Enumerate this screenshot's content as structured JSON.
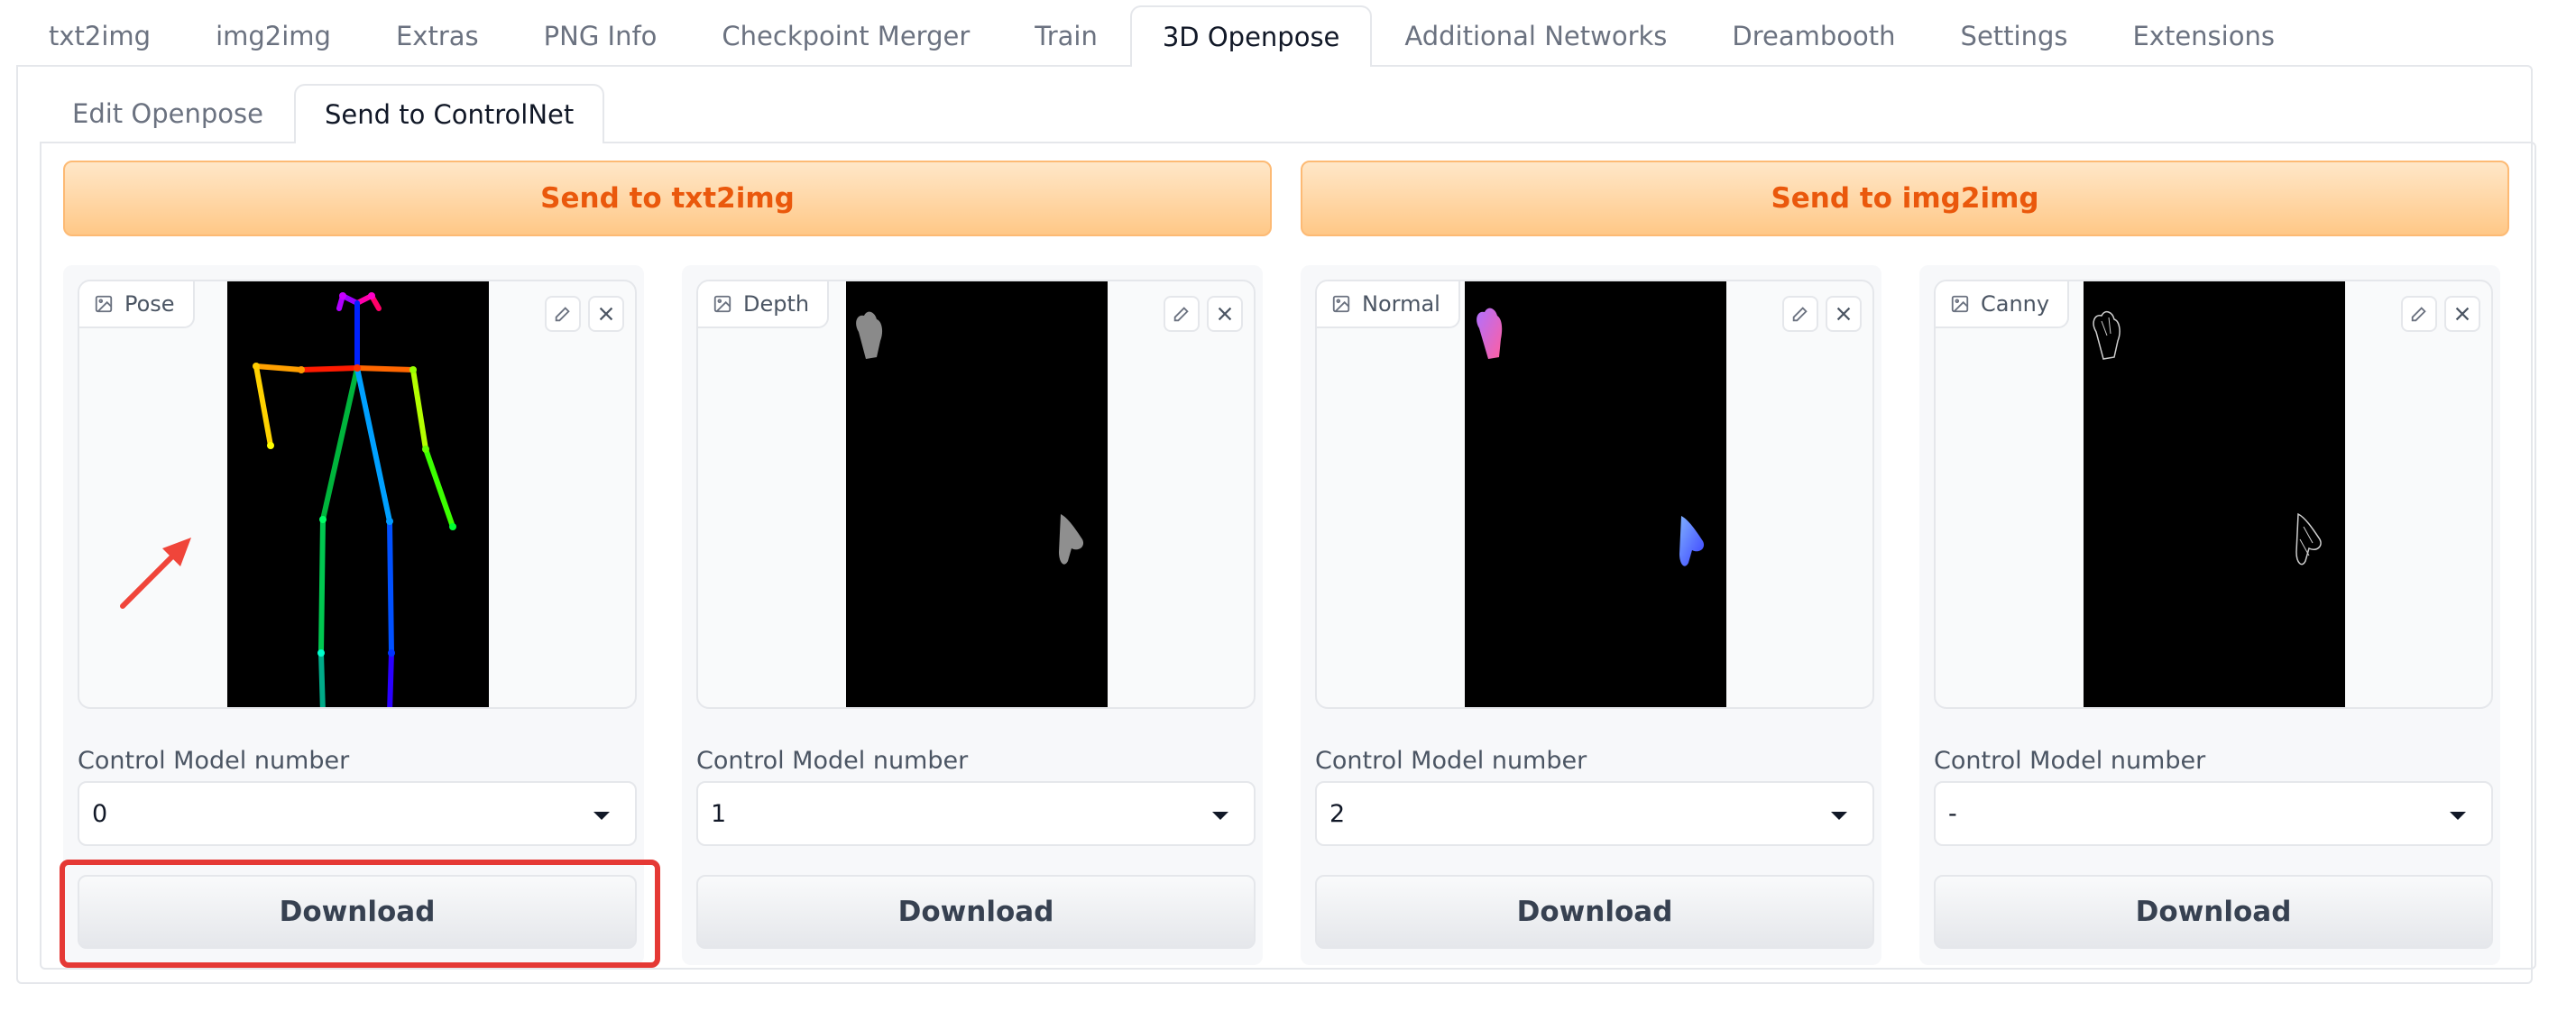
{
  "top_tabs": [
    {
      "label": "txt2img"
    },
    {
      "label": "img2img"
    },
    {
      "label": "Extras"
    },
    {
      "label": "PNG Info"
    },
    {
      "label": "Checkpoint Merger"
    },
    {
      "label": "Train"
    },
    {
      "label": "3D Openpose",
      "active": true
    },
    {
      "label": "Additional Networks"
    },
    {
      "label": "Dreambooth"
    },
    {
      "label": "Settings"
    },
    {
      "label": "Extensions"
    }
  ],
  "sub_tabs": [
    {
      "label": "Edit Openpose"
    },
    {
      "label": "Send to ControlNet",
      "active": true
    }
  ],
  "send_buttons": {
    "txt2img": "Send to txt2img",
    "img2img": "Send to img2img"
  },
  "cards": [
    {
      "label": "Pose",
      "control_model_label": "Control Model number",
      "control_model_value": "0",
      "download_label": "Download"
    },
    {
      "label": "Depth",
      "control_model_label": "Control Model number",
      "control_model_value": "1",
      "download_label": "Download"
    },
    {
      "label": "Normal",
      "control_model_label": "Control Model number",
      "control_model_value": "2",
      "download_label": "Download"
    },
    {
      "label": "Canny",
      "control_model_label": "Control Model number",
      "control_model_value": "-",
      "download_label": "Download"
    }
  ],
  "icons": {
    "image": "image-icon",
    "edit": "pencil-icon",
    "clear": "close-icon",
    "dropdown": "chevron-down-icon"
  },
  "colors": {
    "accent_orange": "#ea580c",
    "highlight_red": "#e53935"
  }
}
